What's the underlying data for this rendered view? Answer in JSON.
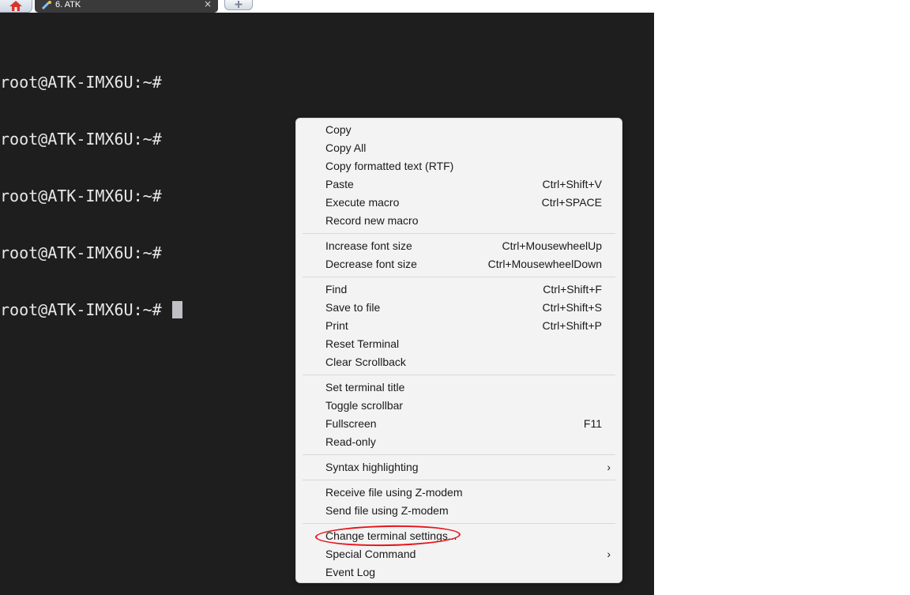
{
  "tabs": {
    "session_label": "6. ATK",
    "close_glyph": "×"
  },
  "terminal": {
    "lines": [
      "root@ATK-IMX6U:~#",
      "root@ATK-IMX6U:~#",
      "root@ATK-IMX6U:~#",
      "root@ATK-IMX6U:~#",
      "root@ATK-IMX6U:~# "
    ]
  },
  "menu": {
    "groups": [
      [
        {
          "label": "Copy",
          "shortcut": ""
        },
        {
          "label": "Copy All",
          "shortcut": ""
        },
        {
          "label": "Copy formatted text (RTF)",
          "shortcut": ""
        },
        {
          "label": "Paste",
          "shortcut": "Ctrl+Shift+V"
        },
        {
          "label": "Execute macro",
          "shortcut": "Ctrl+SPACE"
        },
        {
          "label": "Record new macro",
          "shortcut": ""
        }
      ],
      [
        {
          "label": "Increase font size",
          "shortcut": "Ctrl+MousewheelUp"
        },
        {
          "label": "Decrease font size",
          "shortcut": "Ctrl+MousewheelDown"
        }
      ],
      [
        {
          "label": "Find",
          "shortcut": "Ctrl+Shift+F"
        },
        {
          "label": "Save to file",
          "shortcut": "Ctrl+Shift+S"
        },
        {
          "label": "Print",
          "shortcut": "Ctrl+Shift+P"
        },
        {
          "label": "Reset Terminal",
          "shortcut": ""
        },
        {
          "label": "Clear Scrollback",
          "shortcut": ""
        }
      ],
      [
        {
          "label": "Set terminal title",
          "shortcut": ""
        },
        {
          "label": "Toggle scrollbar",
          "shortcut": ""
        },
        {
          "label": "Fullscreen",
          "shortcut": "F11"
        },
        {
          "label": "Read-only",
          "shortcut": ""
        }
      ],
      [
        {
          "label": "Syntax highlighting",
          "shortcut": "",
          "submenu": true
        }
      ],
      [
        {
          "label": "Receive file using Z-modem",
          "shortcut": ""
        },
        {
          "label": "Send file using Z-modem",
          "shortcut": ""
        }
      ],
      [
        {
          "label": "Change terminal settings...",
          "shortcut": ""
        },
        {
          "label": "Special Command",
          "shortcut": "",
          "submenu": true
        },
        {
          "label": "Event Log",
          "shortcut": ""
        }
      ]
    ],
    "submenu_glyph": "›"
  },
  "colors": {
    "terminal_bg": "#1e1e1e",
    "terminal_fg": "#e8e8e8",
    "menu_bg": "#f3f3f3",
    "annotation_red": "#e8131b"
  }
}
